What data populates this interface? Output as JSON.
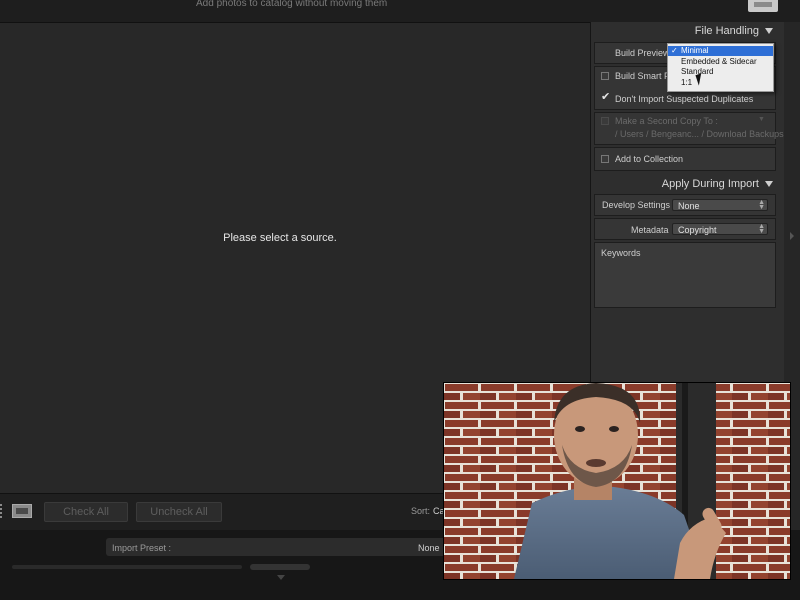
{
  "window": {
    "subtitle": "Add photos to catalog without moving them"
  },
  "grid": {
    "message": "Please select a source."
  },
  "toolbar": {
    "check_all": "Check All",
    "uncheck_all": "Uncheck All",
    "sort_label": "Sort:",
    "sort_value": "Ca"
  },
  "bottom": {
    "import_preset_label": "Import Preset :",
    "import_preset_value": "None"
  },
  "file_handling": {
    "title": "File Handling",
    "build_previews_label": "Build Previews",
    "build_previews_options": [
      "Minimal",
      "Embedded & Sidecar",
      "Standard",
      "1:1"
    ],
    "build_previews_selected": "Minimal",
    "build_smart_previews": "Build Smart Previews",
    "dont_import_duplicates": "Don't Import Suspected Duplicates",
    "dont_import_duplicates_checked": true,
    "make_second_copy": "Make a Second Copy To :",
    "second_copy_path": "/ Users / Bengeanc... / Download Backups",
    "add_to_collection": "Add to Collection"
  },
  "apply_during_import": {
    "title": "Apply During Import",
    "develop_settings_label": "Develop Settings",
    "develop_settings_value": "None",
    "metadata_label": "Metadata",
    "metadata_value": "Copyright",
    "keywords_label": "Keywords"
  },
  "colors": {
    "panel_bg": "#2e2e2e",
    "grid_bg": "#282828",
    "selection_blue": "#2e6fd6"
  },
  "icons": [
    "grid-view-icon",
    "check-icon",
    "cursor-arrow-icon",
    "disclosure-triangle-icon"
  ]
}
